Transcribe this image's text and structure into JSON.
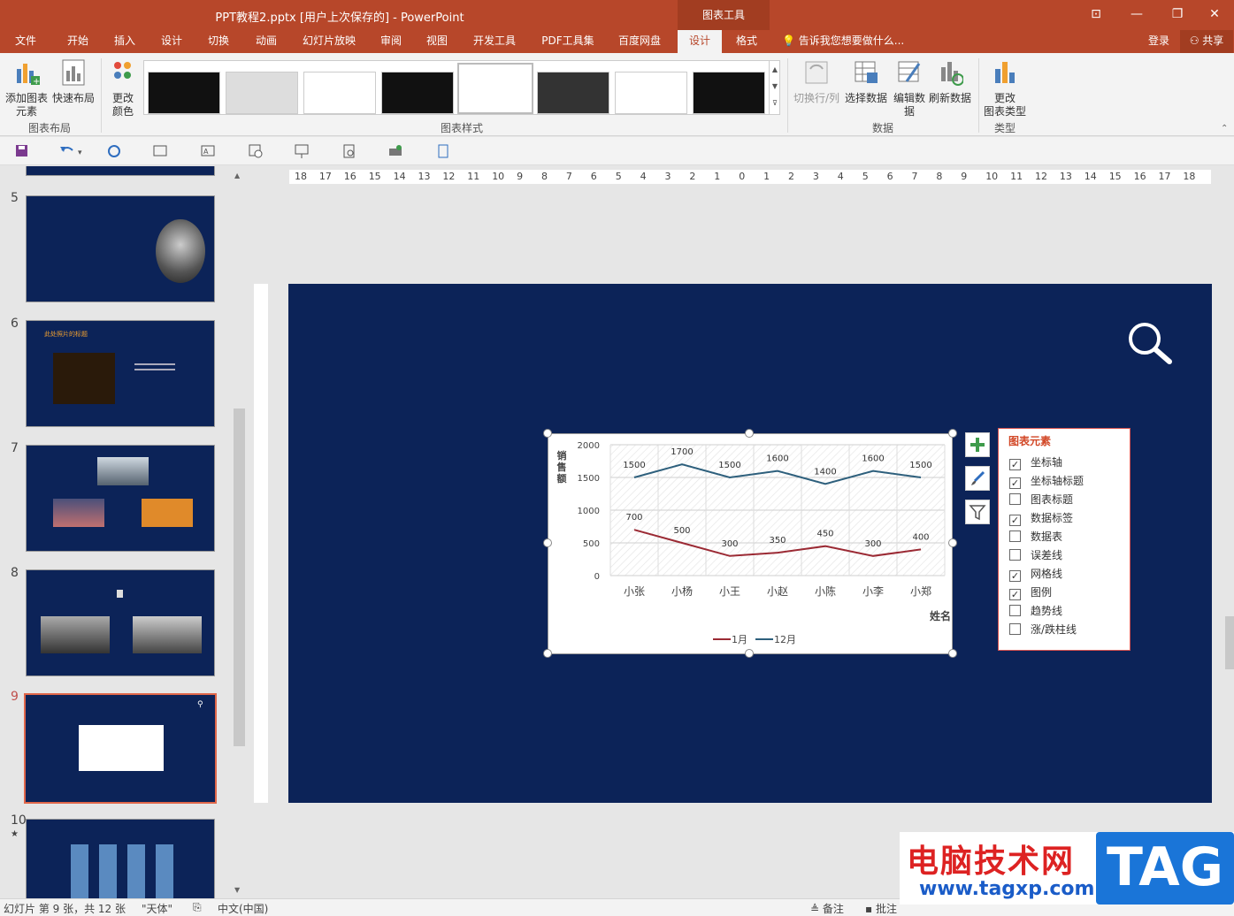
{
  "window": {
    "title": "PPT教程2.pptx [用户上次保存的] - PowerPoint",
    "context_tab_group": "图表工具",
    "min": "—",
    "restore": "❐",
    "close": "✕",
    "ribbon_opts": "⊡"
  },
  "tabs": [
    "文件",
    "开始",
    "插入",
    "设计",
    "切换",
    "动画",
    "幻灯片放映",
    "审阅",
    "视图",
    "开发工具",
    "PDF工具集",
    "百度网盘",
    "设计",
    "格式"
  ],
  "tell_me": "告诉我您想要做什么...",
  "login": "登录",
  "share": "共享",
  "ribbon": {
    "add_element": [
      "添加图表",
      "元素"
    ],
    "quick_layout": "快速布局",
    "change_color": [
      "更改",
      "颜色"
    ],
    "group_layout": "图表布局",
    "group_styles": "图表样式",
    "switch_row_col": "切换行/列",
    "select_data": "选择数据",
    "edit_data": [
      "编辑数",
      "据"
    ],
    "refresh_data": "刷新数据",
    "group_data": "数据",
    "change_type": [
      "更改",
      "图表类型"
    ],
    "group_type": "类型"
  },
  "slides": {
    "numbers": [
      "5",
      "6",
      "7",
      "8",
      "9",
      "10"
    ],
    "slide6_title": "此处照片的标题",
    "slide10_marker": "★"
  },
  "ruler": {
    "h_ticks": [
      "18",
      "17",
      "16",
      "15",
      "14",
      "13",
      "12",
      "11",
      "10",
      "9",
      "8",
      "7",
      "6",
      "5",
      "4",
      "3",
      "2",
      "1",
      "0",
      "1",
      "2",
      "3",
      "4",
      "5",
      "6",
      "7",
      "8",
      "9",
      "10",
      "11",
      "12",
      "13",
      "14",
      "15",
      "16",
      "17",
      "18"
    ]
  },
  "chart_data": {
    "type": "line",
    "categories": [
      "小张",
      "小杨",
      "小王",
      "小赵",
      "小陈",
      "小李",
      "小郑"
    ],
    "series": [
      {
        "name": "1月",
        "values": [
          700,
          500,
          300,
          350,
          450,
          300,
          400
        ],
        "color": "#9b2a34"
      },
      {
        "name": "12月",
        "values": [
          1500,
          1700,
          1500,
          1600,
          1400,
          1600,
          1500
        ],
        "color": "#2d5f7c"
      }
    ],
    "ylabel": "销售额",
    "xlabel": "姓名",
    "ylim": [
      0,
      2000
    ],
    "yticks": [
      "2000",
      "1500",
      "1000",
      "500",
      "0"
    ],
    "grid": true,
    "legend": "bottom"
  },
  "elements_panel": {
    "title": "图表元素",
    "items": [
      {
        "label": "坐标轴",
        "checked": true
      },
      {
        "label": "坐标轴标题",
        "checked": true
      },
      {
        "label": "图表标题",
        "checked": false
      },
      {
        "label": "数据标签",
        "checked": true
      },
      {
        "label": "数据表",
        "checked": false
      },
      {
        "label": "误差线",
        "checked": false
      },
      {
        "label": "网格线",
        "checked": true
      },
      {
        "label": "图例",
        "checked": true
      },
      {
        "label": "趋势线",
        "checked": false
      },
      {
        "label": "涨/跌柱线",
        "checked": false
      }
    ]
  },
  "status": {
    "slide_info": "幻灯片 第 9 张，共 12 张",
    "theme": "\"天体\"",
    "language": "中文(中国)",
    "notes": "备注",
    "comments": "批注"
  },
  "watermark": {
    "cn": "电脑技术网",
    "url": "www.tagxp.com",
    "tag": "TAG"
  },
  "colors": {
    "accent": "#b7472a",
    "slide_bg": "#0c2358",
    "selected_thumb": "#e0674a"
  }
}
